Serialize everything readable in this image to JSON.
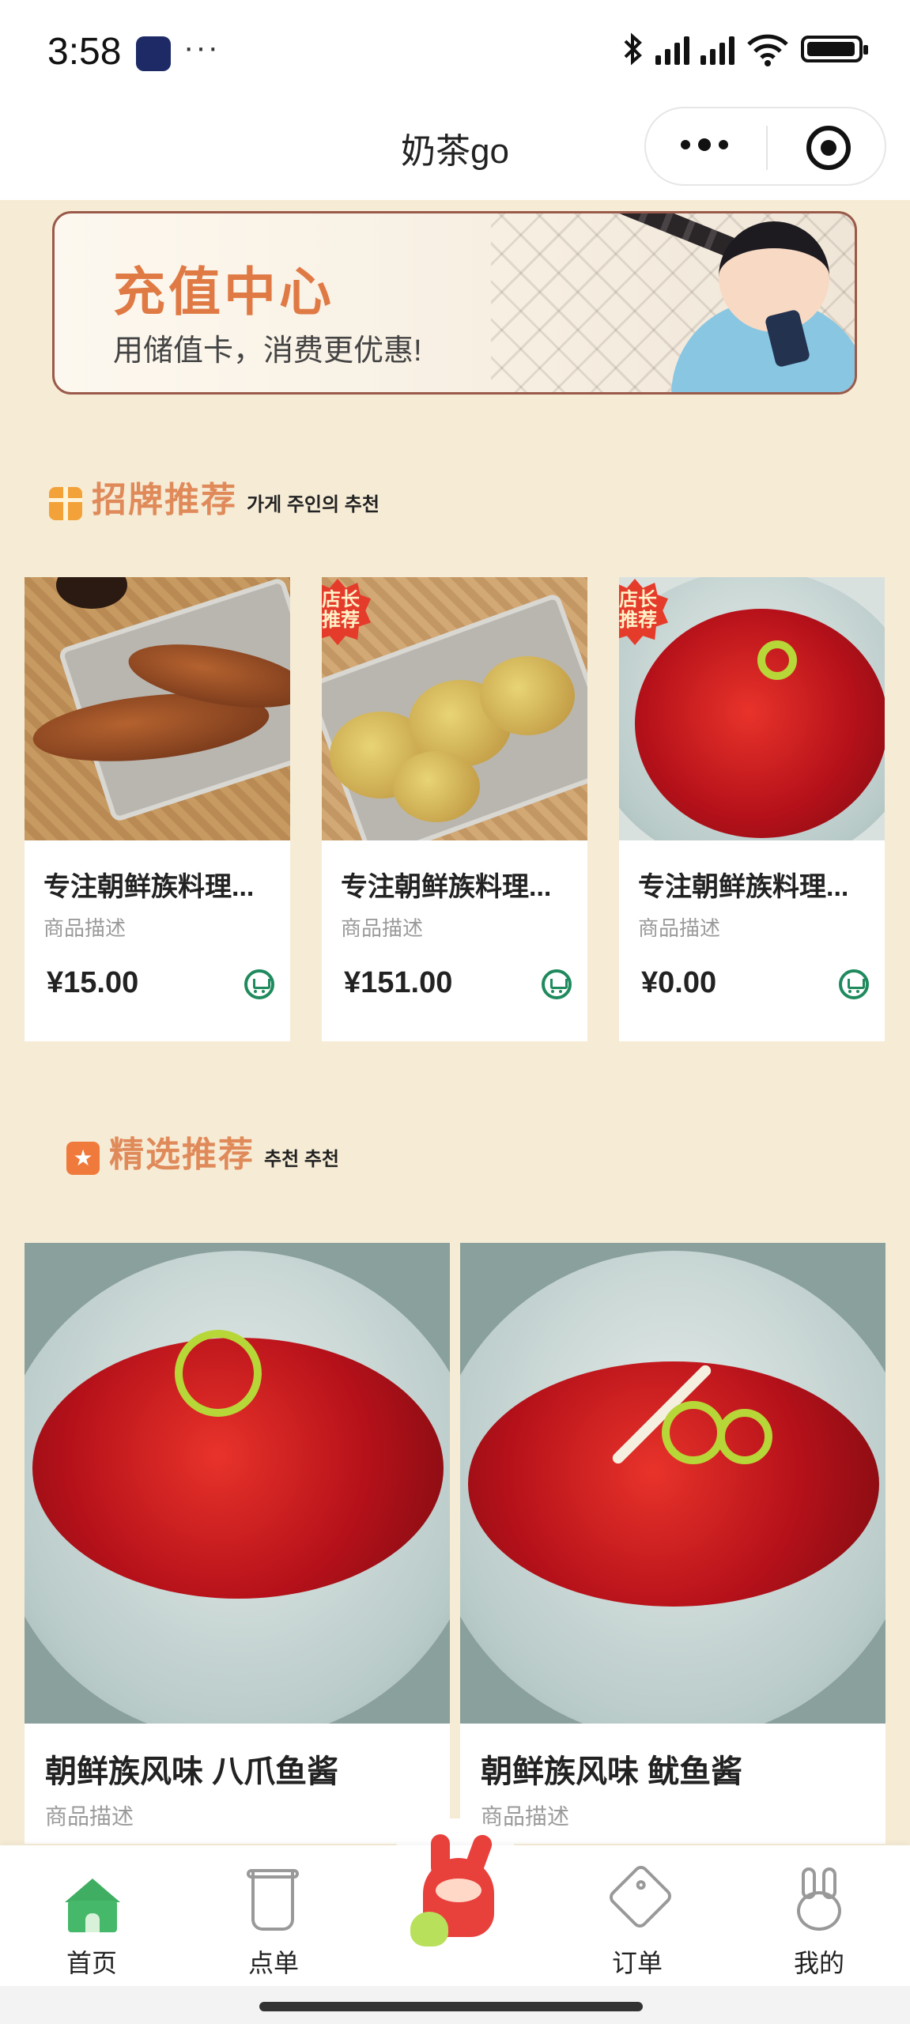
{
  "status_bar": {
    "time": "3:58",
    "dots": "···"
  },
  "nav": {
    "title": "奶茶go"
  },
  "banner": {
    "title": "充值中心",
    "subtitle": "用储值卡，消费更优惠!"
  },
  "signature_section": {
    "title": "招牌推荐",
    "subtitle": "가게 주인의 추천"
  },
  "badge_text": "店长推荐",
  "signature_items": [
    {
      "name": "专注朝鲜族料理...",
      "desc": "商品描述",
      "price": "¥15.00"
    },
    {
      "name": "专注朝鲜族料理...",
      "desc": "商品描述",
      "price": "¥151.00"
    },
    {
      "name": "专注朝鲜族料理...",
      "desc": "商品描述",
      "price": "¥0.00"
    }
  ],
  "featured_section": {
    "title": "精选推荐",
    "subtitle": "추천 추천"
  },
  "featured_items": [
    {
      "name": "朝鲜族风味 八爪鱼酱",
      "desc": "商品描述"
    },
    {
      "name": "朝鲜族风味 鱿鱼酱",
      "desc": "商品描述"
    }
  ],
  "tabs": [
    {
      "label": "首页",
      "icon": "home-icon",
      "active": true
    },
    {
      "label": "点单",
      "icon": "cup-icon"
    },
    {
      "label": "",
      "icon": "mascot-icon"
    },
    {
      "label": "订单",
      "icon": "tag-icon"
    },
    {
      "label": "我的",
      "icon": "rabbit-icon"
    }
  ],
  "colors": {
    "background": "#f6ecd6",
    "accent_orange": "#e07a45",
    "cart_green": "#1f8a5d",
    "home_green": "#46b86a"
  }
}
